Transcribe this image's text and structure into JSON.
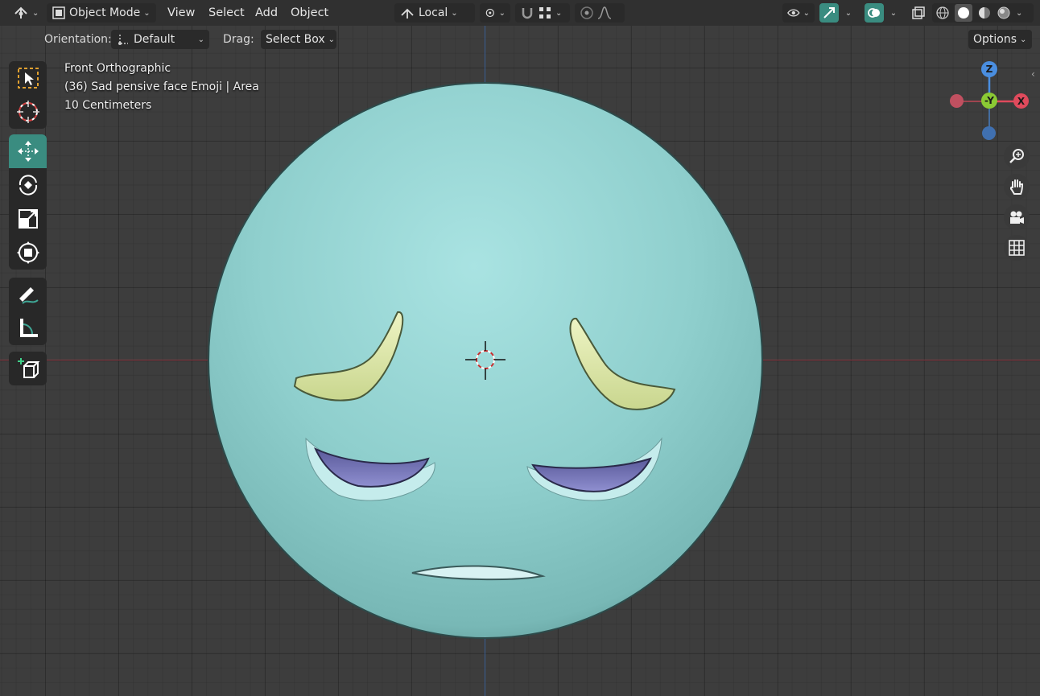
{
  "header": {
    "mode_label": "Object Mode",
    "menus": [
      "View",
      "Select",
      "Add",
      "Object"
    ],
    "transform_orientation": "Local"
  },
  "tool_settings": {
    "orientation_label": "Orientation:",
    "orientation_value": "Default",
    "drag_label": "Drag:",
    "drag_value": "Select Box",
    "options_label": "Options"
  },
  "viewport": {
    "view_name": "Front Orthographic",
    "object_info": "(36) Sad pensive face Emoji | Area",
    "scale_info": "10 Centimeters"
  },
  "gizmo": {
    "z_label": "Z",
    "neg_y_label": "-Y",
    "x_label": "X"
  },
  "colors": {
    "active_tool": "#3a8c80",
    "x_axis": "#e04a5c",
    "y_axis": "#8bc934",
    "z_axis": "#4a8ee0",
    "face": "#8ecccb",
    "eyebrow": "#dfe8a8",
    "eye": "#7f7fc0"
  }
}
